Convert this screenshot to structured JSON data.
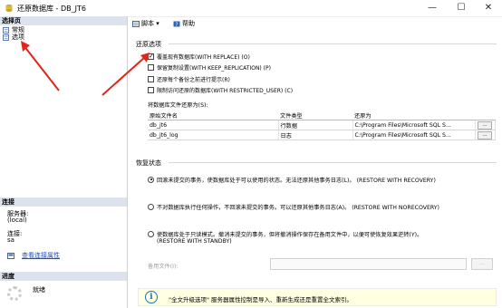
{
  "window": {
    "title": "还原数据库 - DB_JT6",
    "minimize": "—",
    "maximize": "☐",
    "close": "✕"
  },
  "left": {
    "select_page_header": "选择页",
    "pages": [
      {
        "label": "常规",
        "icon": "page-icon"
      },
      {
        "label": "选项",
        "icon": "page-icon"
      }
    ],
    "connection_header": "连接",
    "server_label": "服务器:",
    "server_value": "(local)",
    "connection_label": "连接:",
    "connection_value": "sa",
    "view_conn_props": "查看连接属性",
    "progress_header": "进度",
    "progress_status": "就绪"
  },
  "toolbar": {
    "script_label": "脚本 ▾",
    "help_label": "帮助"
  },
  "restore_options": {
    "group_label": "还原选项",
    "checkboxes": [
      {
        "label": "覆盖现有数据库(WITH REPLACE) (O)",
        "checked": true
      },
      {
        "label": "保留复制设置(WITH KEEP_REPLICATION) (P)",
        "checked": false
      },
      {
        "label": "还原每个备份之前进行提示(R)",
        "checked": false
      },
      {
        "label": "限制访问还原的数据库(WITH RESTRICTED_USER) (C)",
        "checked": false
      }
    ],
    "restore_as_label": "将数据库文件还原为(S):",
    "table": {
      "columns": [
        "原始文件名",
        "文件类型",
        "还原为"
      ],
      "rows": [
        {
          "name": "db_jt6",
          "type": "行数据",
          "path": "C:\\Program Files\\Microsoft SQL S...",
          "btn": "..."
        },
        {
          "name": "db_jt6_log",
          "type": "日志",
          "path": "C:\\Program Files\\Microsoft SQL S...",
          "btn": "..."
        }
      ]
    }
  },
  "recovery_state": {
    "group_label": "恢复状态",
    "options": [
      {
        "line1": "回滚未提交的事务，使数据库处于可以使用的状态。无法还原其他事务日志(L)。 (RESTORE WITH RECOVERY)",
        "line2": "",
        "selected": true
      },
      {
        "line1": "不对数据库执行任何操作，不回滚未提交的事务。可以还原其他事务日志(A)。 (RESTORE WITH NORECOVERY)",
        "line2": "",
        "selected": false
      },
      {
        "line1": "使数据库处于只读模式。撤消未提交的事务，但将撤消操作保存在备用文件中，以便可使恢复效果逆转(Y)。",
        "line2": "(RESTORE WITH STANDBY)",
        "selected": false
      }
    ],
    "standby_label": "备用文件(I):",
    "standby_value": "",
    "standby_btn": "..."
  },
  "info": {
    "icon": "info-icon",
    "text": "\"全文升级选项\" 服务器属性控制是导入、重新生成还是重置全文索引。"
  }
}
